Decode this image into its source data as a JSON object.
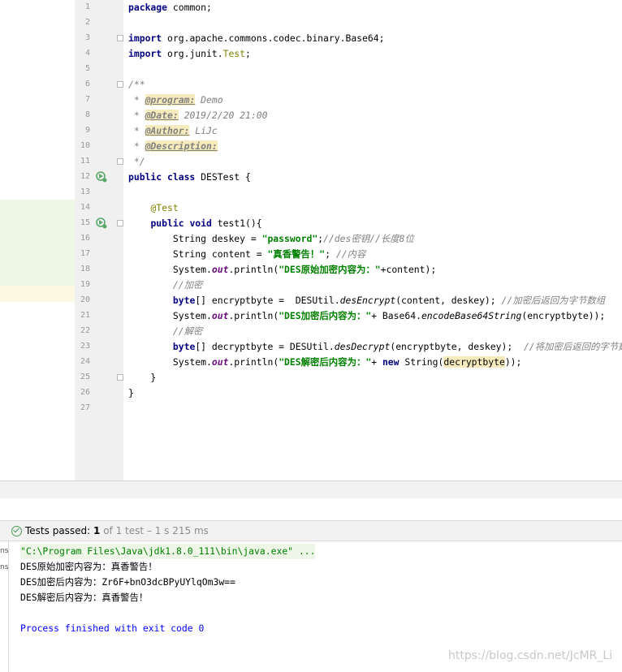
{
  "editor": {
    "line_numbers": [
      "1",
      "2",
      "3",
      "4",
      "5",
      "6",
      "7",
      "8",
      "9",
      "10",
      "11",
      "12",
      "13",
      "14",
      "15",
      "16",
      "17",
      "18",
      "19",
      "20",
      "21",
      "22",
      "23",
      "24",
      "25",
      "26",
      "27"
    ],
    "lines": [
      [
        {
          "t": "package",
          "c": "kw"
        },
        {
          "t": " common;"
        }
      ],
      [],
      [
        {
          "t": "import",
          "c": "kw"
        },
        {
          "t": " org.apache.commons.codec.binary.Base64;"
        }
      ],
      [
        {
          "t": "import",
          "c": "kw"
        },
        {
          "t": " org.junit."
        },
        {
          "t": "Test",
          "c": "ann"
        },
        {
          "t": ";"
        }
      ],
      [],
      [
        {
          "t": "/**",
          "c": "cm"
        }
      ],
      [
        {
          "t": " * ",
          "c": "cm"
        },
        {
          "t": "@program:",
          "c": "tag"
        },
        {
          "t": " Demo",
          "c": "cm"
        }
      ],
      [
        {
          "t": " * ",
          "c": "cm"
        },
        {
          "t": "@Date:",
          "c": "tag"
        },
        {
          "t": " 2019/2/20 21:00",
          "c": "cm"
        }
      ],
      [
        {
          "t": " * ",
          "c": "cm"
        },
        {
          "t": "@Author:",
          "c": "tag"
        },
        {
          "t": " LiJc",
          "c": "cm"
        }
      ],
      [
        {
          "t": " * ",
          "c": "cm"
        },
        {
          "t": "@Description:",
          "c": "tag"
        }
      ],
      [
        {
          "t": " */",
          "c": "cm"
        }
      ],
      [
        {
          "t": "public class",
          "c": "kw"
        },
        {
          "t": " DESTest {"
        }
      ],
      [],
      [
        {
          "t": "    "
        },
        {
          "t": "@Test",
          "c": "ann"
        }
      ],
      [
        {
          "t": "    "
        },
        {
          "t": "public void",
          "c": "kw"
        },
        {
          "t": " test1(){"
        }
      ],
      [
        {
          "t": "        String deskey = "
        },
        {
          "t": "\"password\"",
          "c": "str"
        },
        {
          "t": ";"
        },
        {
          "t": "//des密钥//长度8位",
          "c": "cm"
        }
      ],
      [
        {
          "t": "        String content = "
        },
        {
          "t": "\"真香警告！\"",
          "c": "str"
        },
        {
          "t": "; "
        },
        {
          "t": "//内容",
          "c": "cm"
        }
      ],
      [
        {
          "t": "        System."
        },
        {
          "t": "out",
          "c": "fld"
        },
        {
          "t": ".println("
        },
        {
          "t": "\"DES原始加密内容为：\"",
          "c": "str"
        },
        {
          "t": "+content);"
        }
      ],
      [
        {
          "t": "        "
        },
        {
          "t": "//加密",
          "c": "cm"
        }
      ],
      [
        {
          "t": "        "
        },
        {
          "t": "byte",
          "c": "kw"
        },
        {
          "t": "[] encryptbyte =  DESUtil."
        },
        {
          "t": "desEncrypt",
          "c": "smeth"
        },
        {
          "t": "(content, deskey); "
        },
        {
          "t": "//加密后返回为字节数组",
          "c": "cm"
        }
      ],
      [
        {
          "t": "        System."
        },
        {
          "t": "out",
          "c": "fld"
        },
        {
          "t": ".println("
        },
        {
          "t": "\"DES加密后内容为：\"",
          "c": "str"
        },
        {
          "t": "+ Base64."
        },
        {
          "t": "encodeBase64String",
          "c": "smeth"
        },
        {
          "t": "(encryptbyte));"
        }
      ],
      [
        {
          "t": "        "
        },
        {
          "t": "//解密",
          "c": "cm"
        }
      ],
      [
        {
          "t": "        "
        },
        {
          "t": "byte",
          "c": "kw"
        },
        {
          "t": "[] decryptbyte = DESUtil."
        },
        {
          "t": "desDecrypt",
          "c": "smeth"
        },
        {
          "t": "(encryptbyte, deskey);  "
        },
        {
          "t": "//将加密后返回的字节数组",
          "c": "cm"
        }
      ],
      [
        {
          "t": "        System."
        },
        {
          "t": "out",
          "c": "fld"
        },
        {
          "t": ".println("
        },
        {
          "t": "\"DES解密后内容为：\"",
          "c": "str"
        },
        {
          "t": "+ "
        },
        {
          "t": "new",
          "c": "kw"
        },
        {
          "t": " String("
        },
        {
          "t": "decryptbyte",
          "c": "hl-var"
        },
        {
          "t": "));"
        }
      ],
      [
        {
          "t": "    }"
        }
      ],
      [
        {
          "t": "}"
        }
      ],
      []
    ]
  },
  "test_bar": {
    "label": "Tests passed: ",
    "count": "1",
    "rest": " of 1 test – 1 s 215 ms"
  },
  "console_strip": {
    "a": "ns",
    "b": "ns"
  },
  "console": {
    "cmd": "\"C:\\Program Files\\Java\\jdk1.8.0_111\\bin\\java.exe\" ...",
    "out1": "DES原始加密内容为：真香警告！",
    "out2": "DES加密后内容为：Zr6F+bnO3dcBPyUYlqOm3w==",
    "out3": "DES解密后内容为：真香警告！",
    "exit": "Process finished with exit code 0"
  },
  "watermark": "https://blog.csdn.net/JcMR_Li",
  "colors": {
    "keyword": "#000080",
    "string": "#008000",
    "comment": "#808080",
    "annotation": "#808000",
    "pass": "#499c54"
  }
}
